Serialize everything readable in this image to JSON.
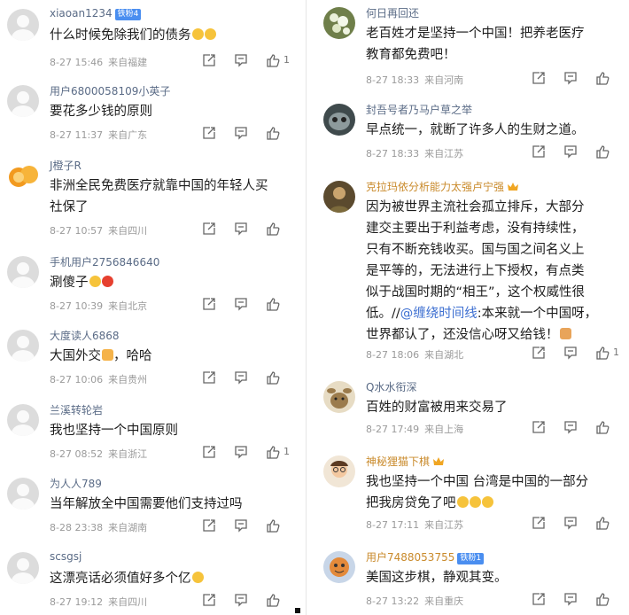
{
  "left": [
    {
      "user": "xiaoan1234",
      "badge": "铁粉4",
      "text": "什么时候免除我们的债务",
      "emoji": "grin-sweat x2",
      "time": "8-27 15:46",
      "loc": "来自福建",
      "likes": "1"
    },
    {
      "user": "用户6800058109小英子",
      "text": "要花多少钱的原则",
      "time": "8-27 11:37",
      "loc": "来自广东",
      "likes": ""
    },
    {
      "user": "J橙子R",
      "text": "非洲全民免费医疗就靠中国的年轻人买\n社保了",
      "time": "8-27 10:57",
      "loc": "来自四川",
      "likes": ""
    },
    {
      "user": "手机用户2756846640",
      "text": "涮傻子",
      "emoji": "smile-tomato",
      "time": "8-27 10:39",
      "loc": "来自北京",
      "likes": ""
    },
    {
      "user": "大度读人6868",
      "text": "大国外交",
      "text2": "，哈哈",
      "emoji": "thumbs-up",
      "time": "8-27 10:06",
      "loc": "来自贵州",
      "likes": ""
    },
    {
      "user": "兰溪转轮岩",
      "text": "我也坚持一个中国原则",
      "time": "8-27 08:52",
      "loc": "来自浙江",
      "likes": "1"
    },
    {
      "user": "为人人789",
      "text": "当年解放全中国需要他们支持过吗",
      "time": "8-28 23:38",
      "loc": "来自湖南",
      "likes": ""
    },
    {
      "user": "scsgsj",
      "text": "这漂亮话必须值好多个亿",
      "emoji": "money-face",
      "time": "8-27 19:12",
      "loc": "来自四川",
      "likes": ""
    }
  ],
  "right": [
    {
      "user": "何日再回还",
      "text": "老百姓才是坚持一个中国！把养老医疗\n教育都免费吧！",
      "time": "8-27 18:33",
      "loc": "来自河南",
      "likes": ""
    },
    {
      "user": "封吾号者乃马户草之举",
      "text": "早点统一，就断了许多人的生财之道。",
      "time": "8-27 18:33",
      "loc": "来自江苏",
      "likes": ""
    },
    {
      "user": "克拉玛依分析能力太强卢宁强",
      "crown": true,
      "text": "因为被世界主流社会孤立排斥，大部分\n建交主要出于利益考虑，没有持续性，\n只有不断充钱收买。国与国之间名义上\n是平等的，无法进行上下授权，有点类\n似于战国时期的“相王”，这个权威性很\n低。//",
      "mention": "@缠绕时间线",
      "text_after": ":本来就一个中国呀，\n世界都认了，还没信心呀又给钱！",
      "time": "8-27 18:06",
      "loc": "来自湖北",
      "likes": "1"
    },
    {
      "user": "Q水水衔深",
      "text": "百姓的财富被用来交易了",
      "time": "8-27 17:49",
      "loc": "来自上海",
      "likes": ""
    },
    {
      "user": "神秘狸猫下棋",
      "crown": true,
      "text": "我也坚持一个中国  台湾是中国的一部分\n把我房贷免了吧",
      "emoji": "grin x3",
      "time": "8-27 17:11",
      "loc": "来自江苏",
      "likes": ""
    },
    {
      "user": "用户7488053755",
      "badge": "铁粉1",
      "text": "美国这步棋，静观其变。",
      "time": "8-27 13:22",
      "loc": "来自重庆",
      "likes": ""
    }
  ],
  "icons": {
    "share": "share-icon",
    "comment": "comment-icon",
    "like": "thumbs-up-icon"
  },
  "colors": {
    "username": "#5a6b86",
    "username_gold": "#c98a2b",
    "badge": "#4a8ef0",
    "meta": "#9a9a9a",
    "mention": "#3d6fd1"
  }
}
